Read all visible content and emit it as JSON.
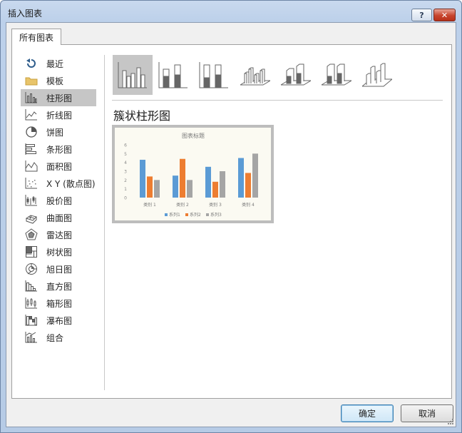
{
  "window": {
    "title": "插入图表"
  },
  "titlebar": {
    "help_label": "?",
    "close_label": "✕"
  },
  "tab": {
    "label": "所有图表"
  },
  "sidebar": {
    "items": [
      {
        "label": "最近",
        "icon": "recent-icon"
      },
      {
        "label": "模板",
        "icon": "folder-icon"
      },
      {
        "label": "柱形图",
        "icon": "column-chart-icon",
        "selected": true
      },
      {
        "label": "折线图",
        "icon": "line-chart-icon"
      },
      {
        "label": "饼图",
        "icon": "pie-chart-icon"
      },
      {
        "label": "条形图",
        "icon": "bar-chart-icon"
      },
      {
        "label": "面积图",
        "icon": "area-chart-icon"
      },
      {
        "label": "X Y (散点图)",
        "icon": "scatter-chart-icon"
      },
      {
        "label": "股价图",
        "icon": "stock-chart-icon"
      },
      {
        "label": "曲面图",
        "icon": "surface-chart-icon"
      },
      {
        "label": "雷达图",
        "icon": "radar-chart-icon"
      },
      {
        "label": "树状图",
        "icon": "treemap-chart-icon"
      },
      {
        "label": "旭日图",
        "icon": "sunburst-chart-icon"
      },
      {
        "label": "直方图",
        "icon": "histogram-chart-icon"
      },
      {
        "label": "箱形图",
        "icon": "box-whisker-chart-icon"
      },
      {
        "label": "瀑布图",
        "icon": "waterfall-chart-icon"
      },
      {
        "label": "组合",
        "icon": "combo-chart-icon"
      }
    ]
  },
  "subtypes": [
    {
      "icon": "clustered-column-icon",
      "selected": true
    },
    {
      "icon": "stacked-column-icon"
    },
    {
      "icon": "100-stacked-column-icon"
    },
    {
      "icon": "3d-clustered-column-icon"
    },
    {
      "icon": "3d-stacked-column-icon"
    },
    {
      "icon": "3d-100-stacked-column-icon"
    },
    {
      "icon": "3d-column-icon"
    }
  ],
  "main": {
    "chart_name": "簇状柱形图"
  },
  "chart_data": {
    "type": "bar",
    "title": "图表标题",
    "categories": [
      "类别 1",
      "类别 2",
      "类别 3",
      "类别 4"
    ],
    "series": [
      {
        "name": "系列1",
        "values": [
          4.3,
          2.5,
          3.5,
          4.5
        ],
        "color": "#5b9bd5"
      },
      {
        "name": "系列2",
        "values": [
          2.4,
          4.4,
          1.8,
          2.8
        ],
        "color": "#ed7d31"
      },
      {
        "name": "系列3",
        "values": [
          2.0,
          2.0,
          3.0,
          5.0
        ],
        "color": "#a5a5a5"
      }
    ],
    "ylim": [
      0,
      6
    ],
    "yticks": [
      "0",
      "1",
      "2",
      "3",
      "4",
      "5",
      "6"
    ],
    "legend": "bottom",
    "grid": false
  },
  "footer": {
    "ok_label": "确定",
    "cancel_label": "取消"
  }
}
